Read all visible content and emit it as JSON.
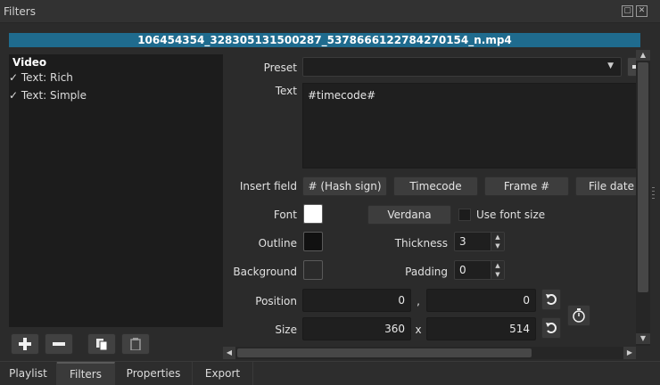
{
  "window": {
    "title": "Filters"
  },
  "file": {
    "name": "106454354_328305131500287_5378666122784270154_n.mp4"
  },
  "filter_list": {
    "group": "Video",
    "items": [
      {
        "check": "✓",
        "label": "Text: Rich",
        "selected": false
      },
      {
        "check": "✓",
        "label": "Text: Simple",
        "selected": true
      }
    ]
  },
  "toolbar": {
    "add": "add-filter-icon",
    "remove": "remove-filter-icon",
    "copy": "copy-icon",
    "paste": "paste-icon"
  },
  "props": {
    "preset_label": "Preset",
    "preset_value": "",
    "text_label": "Text",
    "text_value": "#timecode#",
    "insert_field_label": "Insert field",
    "insert_buttons": [
      "# (Hash sign)",
      "Timecode",
      "Frame #",
      "File date"
    ],
    "font_label": "Font",
    "font_color": "#ffffff",
    "font_button": "Verdana",
    "use_font_size": "Use font size",
    "outline_label": "Outline",
    "outline_color": "#111111",
    "thickness_label": "Thickness",
    "thickness_value": "3",
    "background_label": "Background",
    "background_color": "#2b2b2b",
    "padding_label": "Padding",
    "padding_value": "0",
    "position_label": "Position",
    "position_x": "0",
    "position_sep": ",",
    "position_y": "0",
    "size_label": "Size",
    "size_w": "360",
    "size_sep": "x",
    "size_h": "514"
  },
  "tabs": [
    "Playlist",
    "Filters",
    "Properties",
    "Export"
  ],
  "active_tab": "Filters",
  "colors": {
    "accent": "#1f6b8e",
    "selection": "#2a6a8a"
  }
}
